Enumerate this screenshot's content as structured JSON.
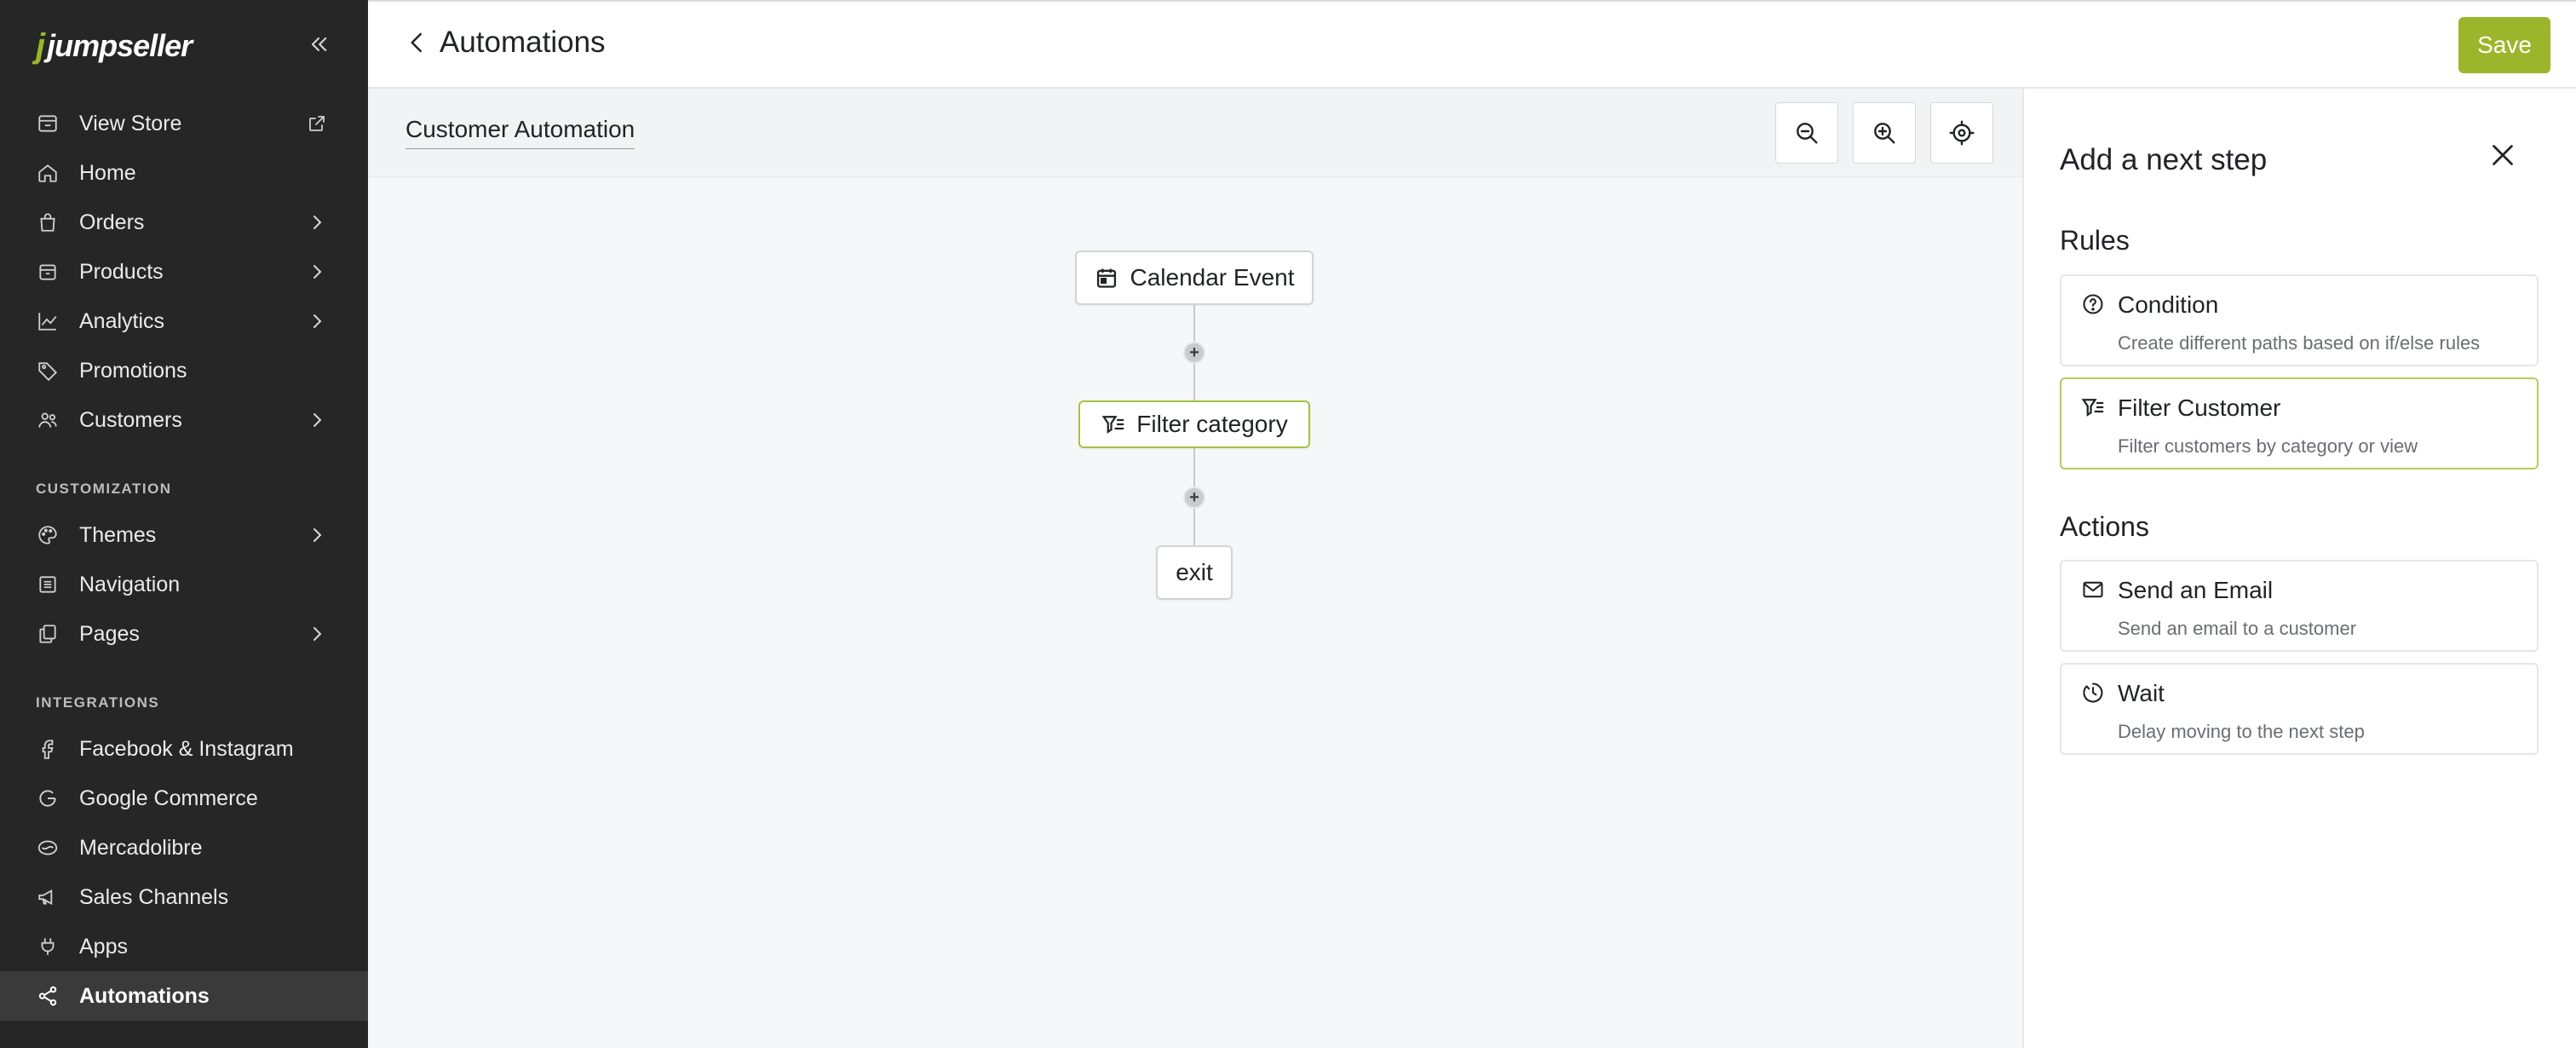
{
  "brand": {
    "logo_text": "jumpseller",
    "accent": "#9bb62a"
  },
  "sidebar": {
    "items": [
      {
        "label": "View Store",
        "icon": "store-icon",
        "trailing": "external-link-icon"
      },
      {
        "label": "Home",
        "icon": "home-icon"
      },
      {
        "label": "Orders",
        "icon": "bag-icon",
        "trailing": "chevron-right-icon"
      },
      {
        "label": "Products",
        "icon": "box-icon",
        "trailing": "chevron-right-icon"
      },
      {
        "label": "Analytics",
        "icon": "chart-icon",
        "trailing": "chevron-right-icon"
      },
      {
        "label": "Promotions",
        "icon": "tag-icon"
      },
      {
        "label": "Customers",
        "icon": "users-icon",
        "trailing": "chevron-right-icon"
      }
    ],
    "customization_label": "CUSTOMIZATION",
    "customization": [
      {
        "label": "Themes",
        "icon": "palette-icon",
        "trailing": "chevron-right-icon"
      },
      {
        "label": "Navigation",
        "icon": "list-icon"
      },
      {
        "label": "Pages",
        "icon": "pages-icon",
        "trailing": "chevron-right-icon"
      }
    ],
    "integrations_label": "INTEGRATIONS",
    "integrations": [
      {
        "label": "Facebook & Instagram",
        "icon": "facebook-icon"
      },
      {
        "label": "Google Commerce",
        "icon": "google-icon"
      },
      {
        "label": "Mercadolibre",
        "icon": "mercadolibre-icon"
      },
      {
        "label": "Sales Channels",
        "icon": "megaphone-icon"
      },
      {
        "label": "Apps",
        "icon": "plug-icon"
      },
      {
        "label": "Automations",
        "icon": "share-icon",
        "active": true
      }
    ]
  },
  "header": {
    "title": "Automations",
    "save_label": "Save"
  },
  "canvas": {
    "automation_name": "Customer Automation",
    "tools": [
      "zoom-out-icon",
      "zoom-in-icon",
      "recenter-icon"
    ],
    "nodes": [
      {
        "label": "Calendar Event",
        "icon": "calendar-icon"
      },
      {
        "label": "Filter category",
        "icon": "filter-icon"
      },
      {
        "label": "exit"
      }
    ],
    "add_step_glyph": "+"
  },
  "panel": {
    "title": "Add a next step",
    "rules_label": "Rules",
    "rules": [
      {
        "title": "Condition",
        "desc": "Create different paths based on if/else rules",
        "icon": "question-icon"
      },
      {
        "title": "Filter Customer",
        "desc": "Filter customers by category or view",
        "icon": "filter-icon",
        "selected": true
      }
    ],
    "actions_label": "Actions",
    "actions": [
      {
        "title": "Send an Email",
        "desc": "Send an email to a customer",
        "icon": "mail-icon"
      },
      {
        "title": "Wait",
        "desc": "Delay moving to the next step",
        "icon": "timer-icon"
      }
    ]
  }
}
